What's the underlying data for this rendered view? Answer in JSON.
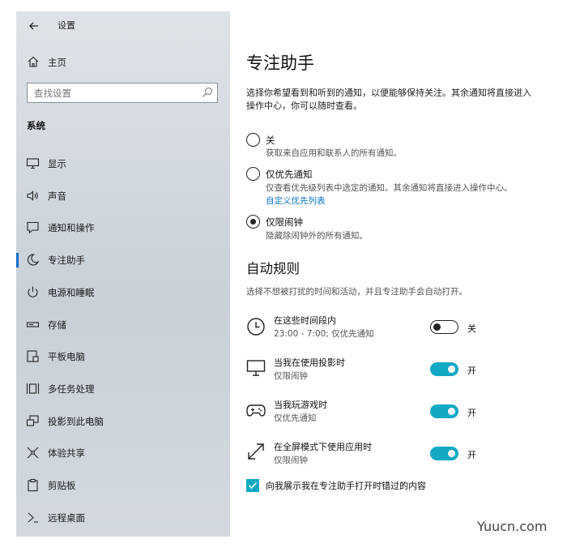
{
  "window": {
    "title": "设置"
  },
  "sidebar": {
    "home_label": "主页",
    "search_placeholder": "查找设置",
    "section_title": "系统",
    "items": [
      {
        "label": "显示",
        "icon": "monitor-icon"
      },
      {
        "label": "声音",
        "icon": "speaker-icon"
      },
      {
        "label": "通知和操作",
        "icon": "notification-icon"
      },
      {
        "label": "专注助手",
        "icon": "moon-icon",
        "selected": true
      },
      {
        "label": "电源和睡眠",
        "icon": "power-icon"
      },
      {
        "label": "存储",
        "icon": "storage-icon"
      },
      {
        "label": "平板电脑",
        "icon": "tablet-icon"
      },
      {
        "label": "多任务处理",
        "icon": "multitask-icon"
      },
      {
        "label": "投影到此电脑",
        "icon": "project-icon"
      },
      {
        "label": "体验共享",
        "icon": "share-icon"
      },
      {
        "label": "剪贴板",
        "icon": "clipboard-icon"
      },
      {
        "label": "远程桌面",
        "icon": "remote-icon"
      }
    ]
  },
  "main": {
    "title": "专注助手",
    "description": "选择你希望看到和听到的通知，以便能够保持关注。其余通知将直接进入操作中心，你可以随时查看。",
    "options": [
      {
        "label": "关",
        "sub": "获取来自应用和联系人的所有通知。",
        "selected": false
      },
      {
        "label": "仅优先通知",
        "sub": "仅查看优先级列表中选定的通知。其余通知将直接进入操作中心。",
        "link": "自定义优先列表",
        "selected": false
      },
      {
        "label": "仅限闹钟",
        "sub": "隐藏除闹钟外的所有通知。",
        "selected": true
      }
    ],
    "rules_title": "自动规则",
    "rules_desc": "选择不想被打扰的时间和活动，并且专注助手会自动打开。",
    "rules": [
      {
        "title": "在这些时间段内",
        "sub": "23:00 - 7:00; 仅优先通知",
        "state": "关",
        "on": false,
        "icon": "clock-icon"
      },
      {
        "title": "当我在使用投影时",
        "sub": "仅限闹钟",
        "state": "开",
        "on": true,
        "icon": "display-icon"
      },
      {
        "title": "当我玩游戏时",
        "sub": "仅优先通知",
        "state": "开",
        "on": true,
        "icon": "gamepad-icon"
      },
      {
        "title": "在全屏模式下使用应用时",
        "sub": "仅限闹钟",
        "state": "开",
        "on": true,
        "icon": "fullscreen-icon"
      }
    ],
    "checkbox_label": "向我展示我在专注助手打开时错过的内容",
    "checkbox_checked": true
  },
  "colors": {
    "accent": "#11a9c4",
    "link": "#0a73c9",
    "selection_bar": "#0a6cc7"
  },
  "watermark": "Yuucn.com"
}
